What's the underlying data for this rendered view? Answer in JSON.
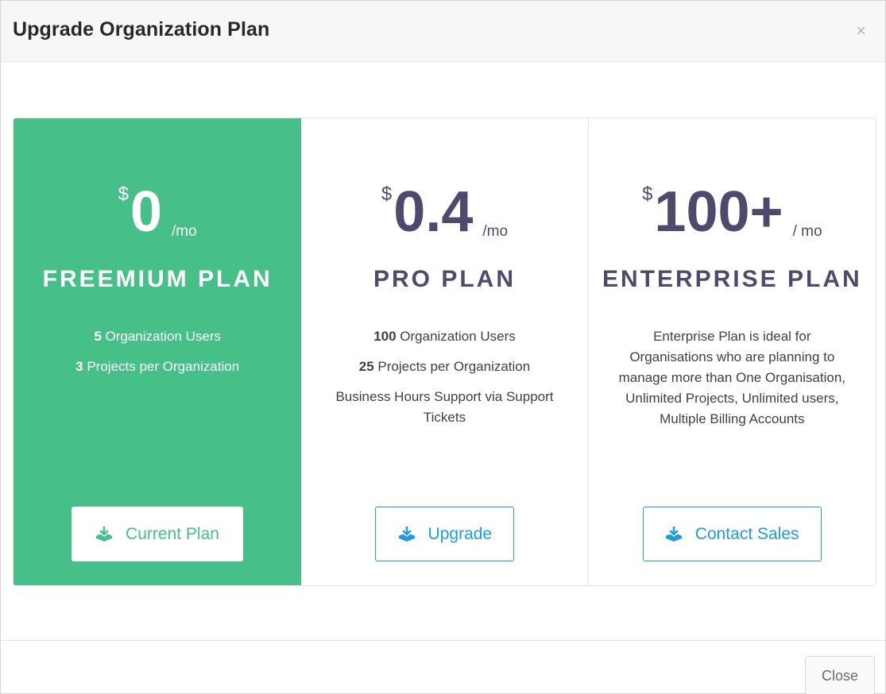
{
  "header": {
    "title": "Upgrade Organization Plan",
    "close_glyph": "×"
  },
  "plans": [
    {
      "currency": "$",
      "amount": "0",
      "period": "/mo",
      "name": "FREEMIUM PLAN",
      "features": [
        {
          "count": "5",
          "text": " Organization Users"
        },
        {
          "count": "3",
          "text": " Projects per Organization"
        }
      ],
      "button": {
        "label": "Current Plan",
        "icon": "download-tray-icon"
      },
      "color": "#46bf88"
    },
    {
      "currency": "$",
      "amount": "0.4",
      "period": "/mo",
      "name": "PRO PLAN",
      "features": [
        {
          "count": "100",
          "text": " Organization Users"
        },
        {
          "count": "25",
          "text": " Projects per Organization"
        },
        {
          "count": "",
          "text": "Business Hours Support via Support Tickets"
        }
      ],
      "button": {
        "label": "Upgrade",
        "icon": "download-tray-icon"
      },
      "color": "#1e9de3"
    },
    {
      "currency": "$",
      "amount": "100+",
      "period": "/ mo",
      "name": "ENTERPRISE PLAN",
      "description": "Enterprise Plan is ideal for Organisations who are planning to manage more than One Organisation, Unlimited Projects, Unlimited users, Multiple Billing Accounts",
      "button": {
        "label": "Contact Sales",
        "icon": "download-tray-icon"
      },
      "color": "#1e9de3"
    }
  ],
  "footer": {
    "close_label": "Close"
  }
}
